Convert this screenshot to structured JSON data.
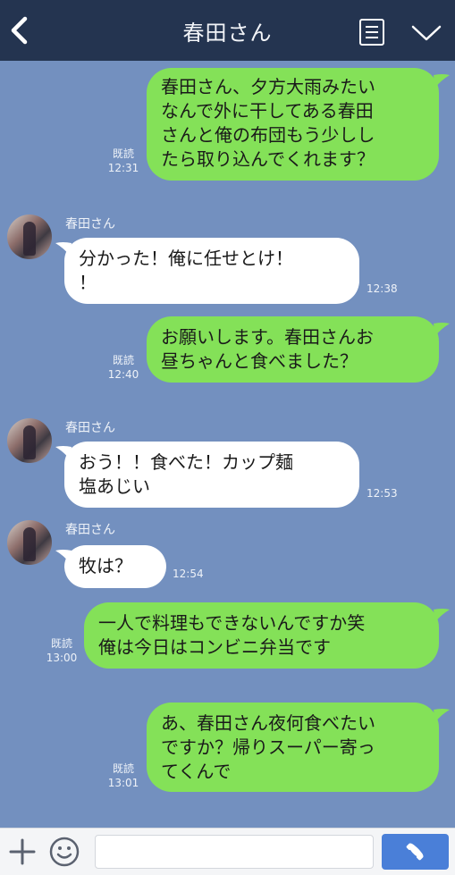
{
  "header": {
    "title": "春田さん",
    "icons": [
      "back-icon",
      "notes-icon",
      "chevron-down-icon"
    ]
  },
  "contact_name": "春田さん",
  "messages": [
    {
      "side": "out",
      "text": "春田さん、夕方大雨みたい\nなんで外に干してある春田\nさんと俺の布団もう少しし\nたら取り込んでくれます？",
      "read": "既読",
      "time": "12:31"
    },
    {
      "side": "in",
      "sender": "春田さん",
      "text": "分かった！俺に任せとけ！\n！",
      "time": "12:38"
    },
    {
      "side": "out",
      "text": "お願いします。春田さんお\n昼ちゃんと食べました？",
      "read": "既読",
      "time": "12:40"
    },
    {
      "side": "in",
      "sender": "春田さん",
      "text": "おう！！食べた！カップ麺\n塩あじい",
      "time": "12:53"
    },
    {
      "side": "in",
      "sender": "春田さん",
      "text": "牧は？",
      "time": "12:54"
    },
    {
      "side": "out",
      "text": "一人で料理もできないんですか笑\n俺は今日はコンビニ弁当です",
      "read": "既読",
      "time": "13:00"
    },
    {
      "side": "out",
      "text": "あ、春田さん夜何食べたい\nですか？帰りスーパー寄っ\nてくんで",
      "read": "既読",
      "time": "13:01"
    }
  ],
  "footer": {
    "input_value": "",
    "icons": [
      "plus-icon",
      "smile-icon",
      "phone-icon"
    ]
  },
  "colors": {
    "chat_background": "#7390bf",
    "header_background": "#243450",
    "outgoing_bubble": "#84e158",
    "incoming_bubble": "#ffffff",
    "call_button": "#4a7fd8"
  }
}
